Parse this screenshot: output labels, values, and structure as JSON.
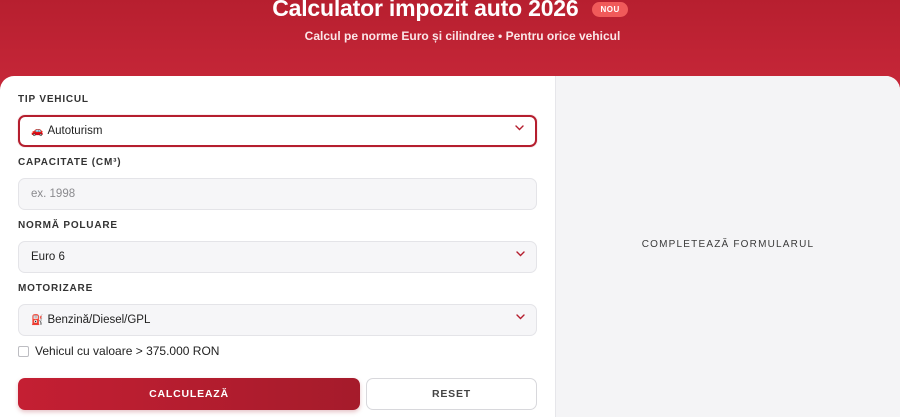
{
  "header": {
    "title": "Calculator impozit auto 2026",
    "badge": "NOU",
    "subtitle": "Calcul pe norme Euro și cilindree • Pentru orice vehicul"
  },
  "form": {
    "vehicle_type": {
      "label": "TIP VEHICUL",
      "icon": "🚗",
      "value": "Autoturism"
    },
    "capacity": {
      "label": "CAPACITATE (CM³)",
      "placeholder": "ex. 1998"
    },
    "pollution_norm": {
      "label": "NORMĂ POLUARE",
      "value": "Euro 6"
    },
    "engine": {
      "label": "MOTORIZARE",
      "icon": "⛽",
      "value": "Benzină/Diesel/GPL"
    },
    "high_value_checkbox": {
      "label": "Vehicul cu valoare > 375.000 RON",
      "checked": false
    },
    "buttons": {
      "calculate": "CALCULEAZĂ",
      "reset": "RESET"
    }
  },
  "result": {
    "placeholder_text": "COMPLETEAZĂ FORMULARUL"
  },
  "colors": {
    "brand": "#b71f2f",
    "accent": "#c41f33",
    "badge": "#f05a5a"
  }
}
